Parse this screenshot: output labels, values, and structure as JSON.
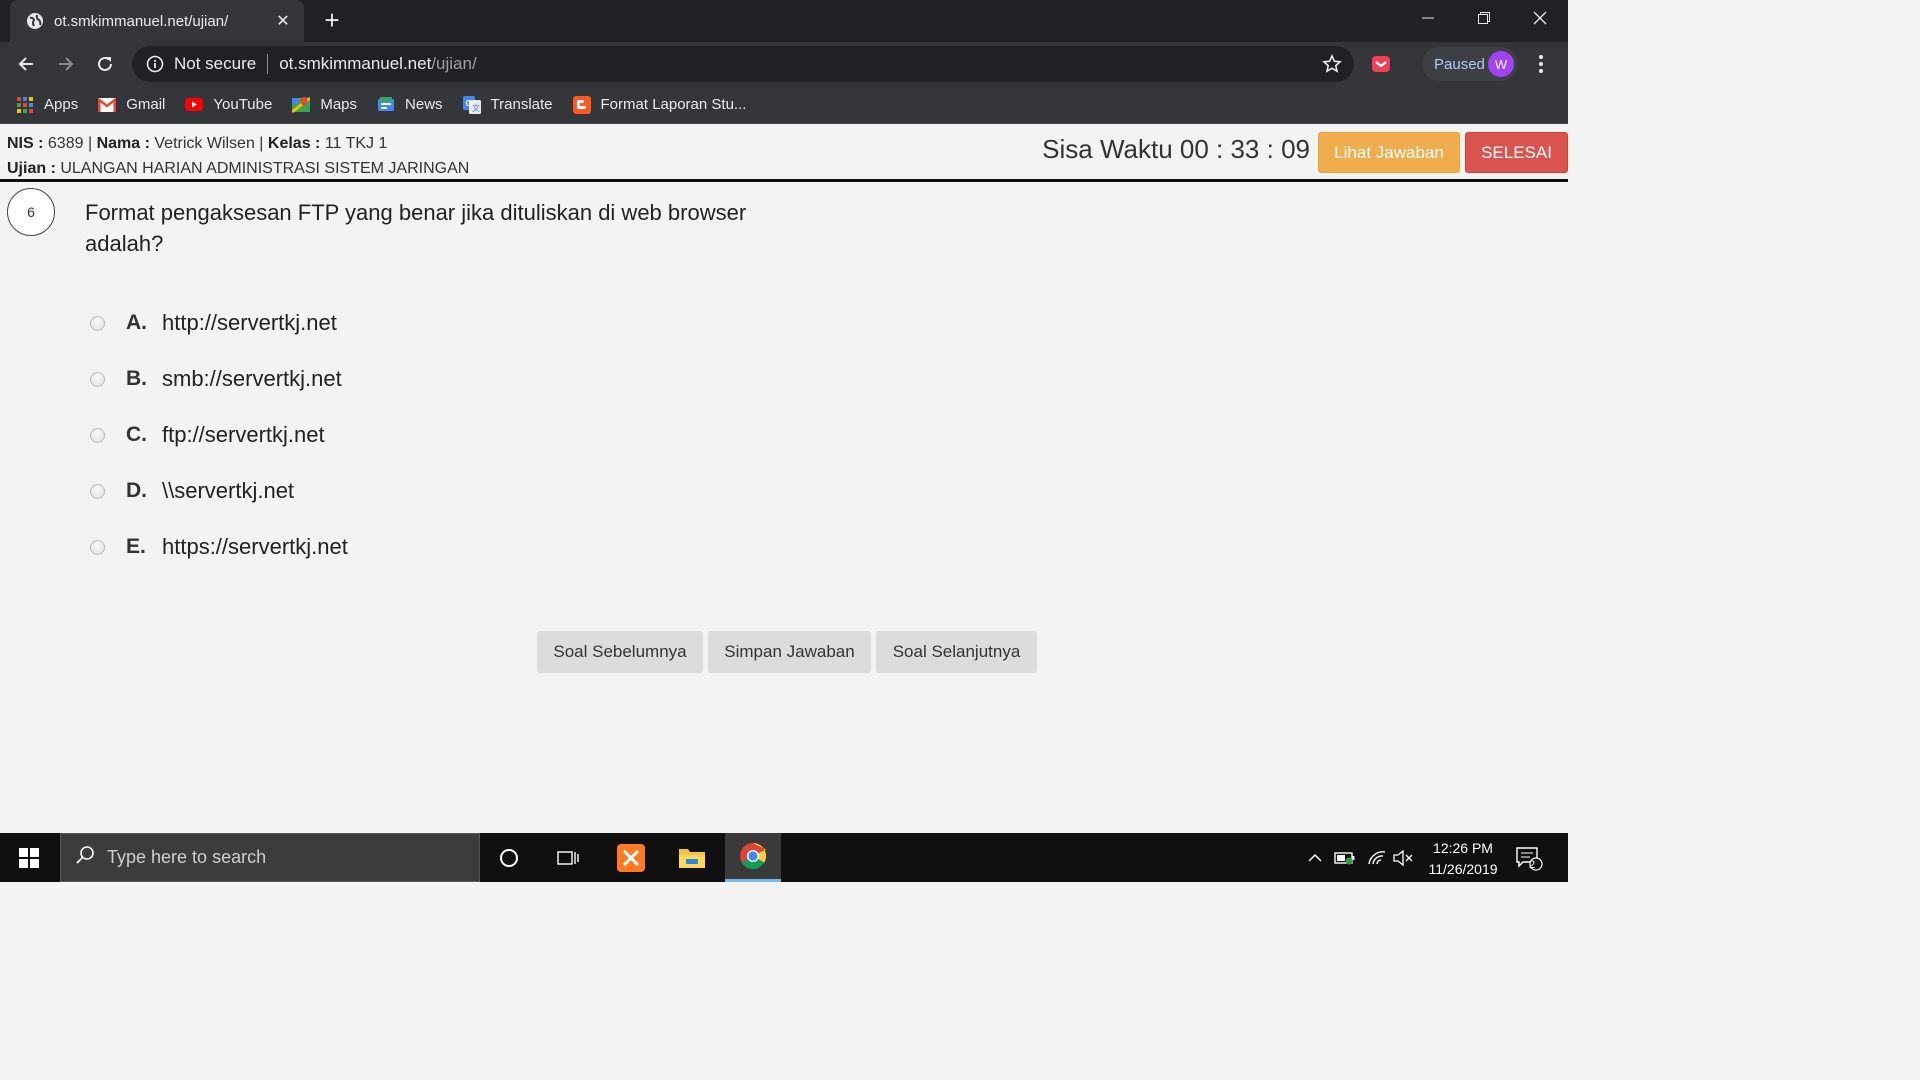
{
  "browser": {
    "tab_title": "ot.smkimmanuel.net/ujian/",
    "tab_close": "✕",
    "new_tab": "+",
    "security_label": "Not secure",
    "url_host": "ot.smkimmanuel.net",
    "url_path": "/ujian/",
    "profile_status": "Paused",
    "profile_initial": "W",
    "bookmarks": [
      {
        "label": "Apps",
        "icon": "apps-grid-icon"
      },
      {
        "label": "Gmail",
        "icon": "gmail-icon"
      },
      {
        "label": "YouTube",
        "icon": "youtube-icon"
      },
      {
        "label": "Maps",
        "icon": "maps-icon"
      },
      {
        "label": "News",
        "icon": "news-icon"
      },
      {
        "label": "Translate",
        "icon": "translate-icon"
      },
      {
        "label": "Format Laporan Stu...",
        "icon": "blogger-icon"
      }
    ]
  },
  "exam": {
    "nis_label": "NIS :",
    "nis_value": "6389",
    "nama_label": "Nama :",
    "nama_value": "Vetrick Wilsen",
    "kelas_label": "Kelas :",
    "kelas_value": "11 TKJ 1",
    "sep": "|",
    "ujian_label": "Ujian :",
    "ujian_value": "ULANGAN HARIAN ADMINISTRASI SISTEM JARINGAN",
    "timer_text": "Sisa Waktu 00 : 33 : 09",
    "lihat_button": "Lihat Jawaban",
    "selesai_button": "SELESAI",
    "question_number": "6",
    "question_text": "Format pengaksesan FTP yang benar jika dituliskan di web browser adalah?",
    "options": [
      {
        "letter": "A.",
        "text": "http://servertkj.net"
      },
      {
        "letter": "B.",
        "text": "smb://servertkj.net"
      },
      {
        "letter": "C.",
        "text": "ftp://servertkj.net"
      },
      {
        "letter": "D.",
        "text": "\\\\servertkj.net"
      },
      {
        "letter": "E.",
        "text": "https://servertkj.net"
      }
    ],
    "prev_button": "Soal Sebelumnya",
    "save_button": "Simpan Jawaban",
    "next_button": "Soal Selanjutnya"
  },
  "taskbar": {
    "search_placeholder": "Type here to search",
    "time": "12:26 PM",
    "date": "11/26/2019",
    "notification_count": "2"
  },
  "colors": {
    "warning": "#f0ad4e",
    "danger": "#d9534f",
    "chrome_dark": "#202124",
    "chrome_toolbar": "#35363a"
  }
}
